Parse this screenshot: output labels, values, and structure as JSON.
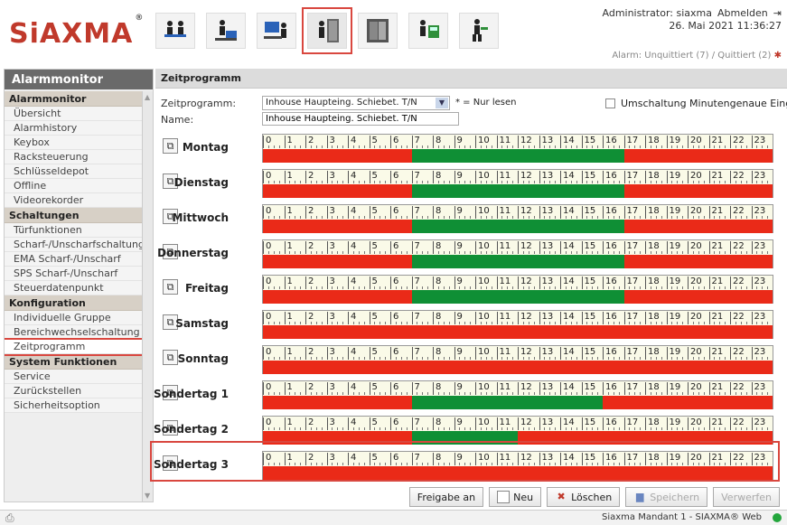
{
  "header": {
    "logo_text": "SiAXMA",
    "logo_mark": "®",
    "user_line": "Administrator: siaxma",
    "logout": "Abmelden",
    "datetime": "26. Mai 2021 11:36:27",
    "alarm_status": "Alarm: Unquittiert (7) / Quittiert (2)",
    "nav_icons": [
      "meeting-icon",
      "guard-desk-icon",
      "operator-icon",
      "door-person-icon",
      "door-icon",
      "worker-machine-icon",
      "worker-icon"
    ]
  },
  "sidebar": {
    "title": "Alarmmonitor",
    "sections": [
      {
        "label": "Alarmmonitor",
        "items": [
          "Übersicht",
          "Alarmhistory",
          "Keybox",
          "Racksteuerung",
          "Schlüsseldepot",
          "Offline",
          "Videorekorder"
        ]
      },
      {
        "label": "Schaltungen",
        "items": [
          "Türfunktionen",
          "Scharf-/Unscharfschaltung",
          "EMA Scharf-/Unscharf",
          "SPS Scharf-/Unscharf",
          "Steuerdatenpunkt"
        ]
      },
      {
        "label": "Konfiguration",
        "items": [
          "Individuelle Gruppe",
          "Bereichwechselschaltung",
          "Zeitprogramm"
        ]
      },
      {
        "label": "System Funktionen",
        "items": [
          "Service",
          "Zurückstellen",
          "Sicherheitsoption"
        ]
      }
    ],
    "active_item": "Zeitprogramm"
  },
  "main": {
    "title": "Zeitprogramm",
    "zp_label": "Zeitprogramm:",
    "zp_value": "Inhouse Haupteing. Schiebet. T/N",
    "readonly_note": "* = Nur lesen",
    "name_label": "Name:",
    "name_value": "Inhouse Haupteing. Schiebet. T/N",
    "minute_check_label": "Umschaltung Minutengenaue Eingabe",
    "hours": [
      "0",
      "1",
      "2",
      "3",
      "4",
      "5",
      "6",
      "7",
      "8",
      "9",
      "10",
      "11",
      "12",
      "13",
      "14",
      "15",
      "16",
      "17",
      "18",
      "19",
      "20",
      "21",
      "22",
      "23"
    ],
    "days": [
      {
        "name": "Montag",
        "green": [
          7,
          17
        ]
      },
      {
        "name": "Dienstag",
        "green": [
          7,
          17
        ]
      },
      {
        "name": "Mittwoch",
        "green": [
          7,
          17
        ]
      },
      {
        "name": "Donnerstag",
        "green": [
          7,
          17
        ]
      },
      {
        "name": "Freitag",
        "green": [
          7,
          17
        ]
      },
      {
        "name": "Samstag",
        "green": null
      },
      {
        "name": "Sonntag",
        "green": null
      },
      {
        "name": "Sondertag 1",
        "green": [
          7,
          16
        ]
      },
      {
        "name": "Sondertag 2",
        "green": [
          7,
          12
        ]
      },
      {
        "name": "Sondertag 3",
        "green": null
      }
    ]
  },
  "buttons": {
    "freigabe": "Freigabe an",
    "neu": "Neu",
    "loeschen": "Löschen",
    "speichern": "Speichern",
    "verwerfen": "Verwerfen"
  },
  "footer": {
    "text": "Siaxma Mandant 1 - SIAXMA® Web"
  }
}
